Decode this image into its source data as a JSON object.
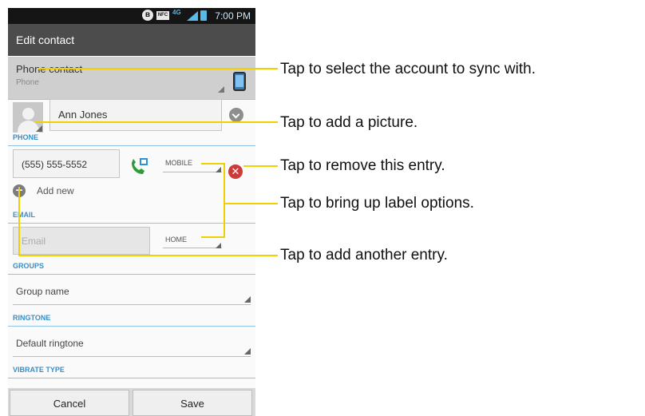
{
  "status_bar": {
    "time": "7:00 PM",
    "nfc": "NFC",
    "network": "4G"
  },
  "action_bar": {
    "title": "Edit contact"
  },
  "account": {
    "name": "Phone contact",
    "type": "Phone"
  },
  "contact": {
    "name": "Ann Jones"
  },
  "phone_section": {
    "label": "PHONE",
    "number": "(555) 555-5552",
    "type": "MOBILE",
    "add_new": "Add new"
  },
  "email_section": {
    "label": "EMAIL",
    "placeholder": "Email",
    "type": "HOME"
  },
  "groups_section": {
    "label": "GROUPS",
    "value": "Group name"
  },
  "ringtone_section": {
    "label": "RINGTONE",
    "value": "Default ringtone"
  },
  "vibrate_section": {
    "label": "VIBRATE TYPE"
  },
  "buttons": {
    "cancel": "Cancel",
    "save": "Save"
  },
  "callouts": [
    "Tap to select the account to sync with.",
    "Tap to add a picture.",
    "Tap to remove this entry.",
    "Tap to bring up label options.",
    "Tap to add another entry."
  ],
  "colors": {
    "accent": "#3b8fc7",
    "leader_line": "#f0d000",
    "action_bar": "#4c4c4c",
    "remove": "#cc3a3a",
    "call_icon": "#2e9a3a"
  }
}
